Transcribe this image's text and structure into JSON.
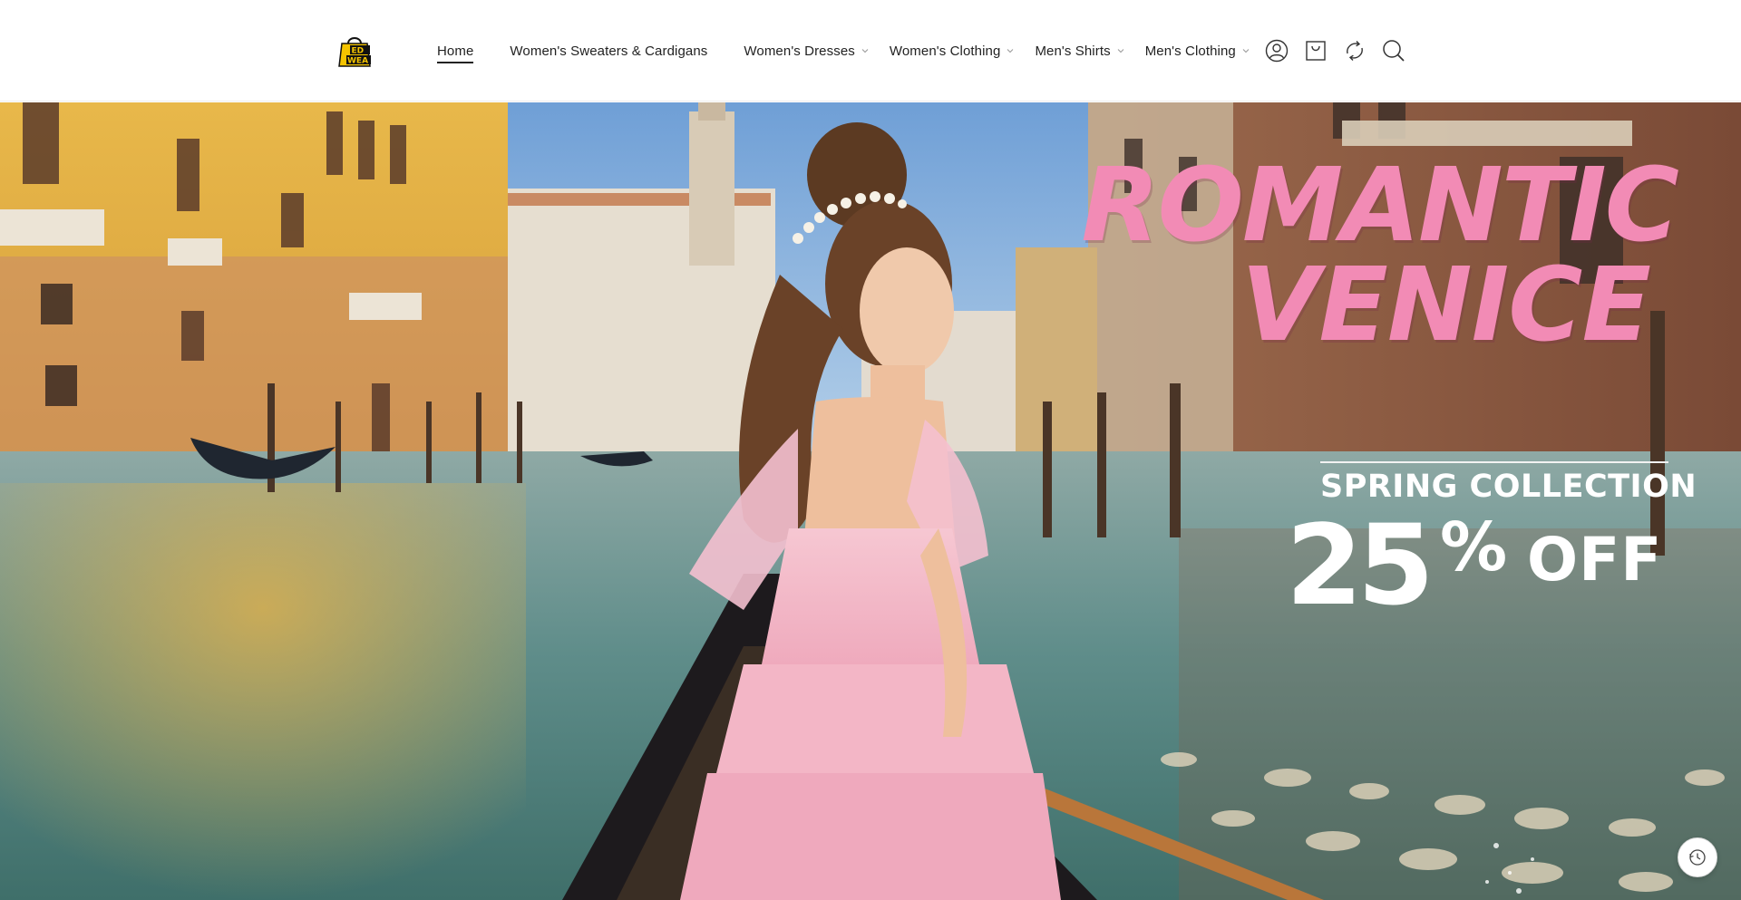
{
  "brand": {
    "logo_icon": "shopping-bag-logo-icon",
    "logo_text_lines": [
      "ED",
      "WEA"
    ],
    "logo_color": "#f5c400"
  },
  "nav": {
    "items": [
      {
        "label": "Home",
        "active": true,
        "has_dropdown": false
      },
      {
        "label": "Women's Sweaters & Cardigans",
        "active": false,
        "has_dropdown": false
      },
      {
        "label": "Women's Dresses",
        "active": false,
        "has_dropdown": true
      },
      {
        "label": "Women's Clothing",
        "active": false,
        "has_dropdown": true
      },
      {
        "label": "Men's Shirts",
        "active": false,
        "has_dropdown": true
      },
      {
        "label": "Men's Clothing",
        "active": false,
        "has_dropdown": true
      }
    ],
    "dropdown_icon": "chevron-down-icon"
  },
  "header_icons": [
    "account-icon",
    "cart-icon",
    "refresh-icon",
    "search-icon"
  ],
  "hero": {
    "title_line1": "ROMANTIC",
    "title_line2": "VENICE",
    "subtitle": "SPRING COLLECTION",
    "offer_number": "25",
    "offer_percent": "%",
    "offer_suffix": "OFF",
    "title_color": "#f28bb5",
    "scene": "woman in pink tulle dress on gondola in Venice canal"
  },
  "floating_button": {
    "icon": "history-clock-icon"
  }
}
